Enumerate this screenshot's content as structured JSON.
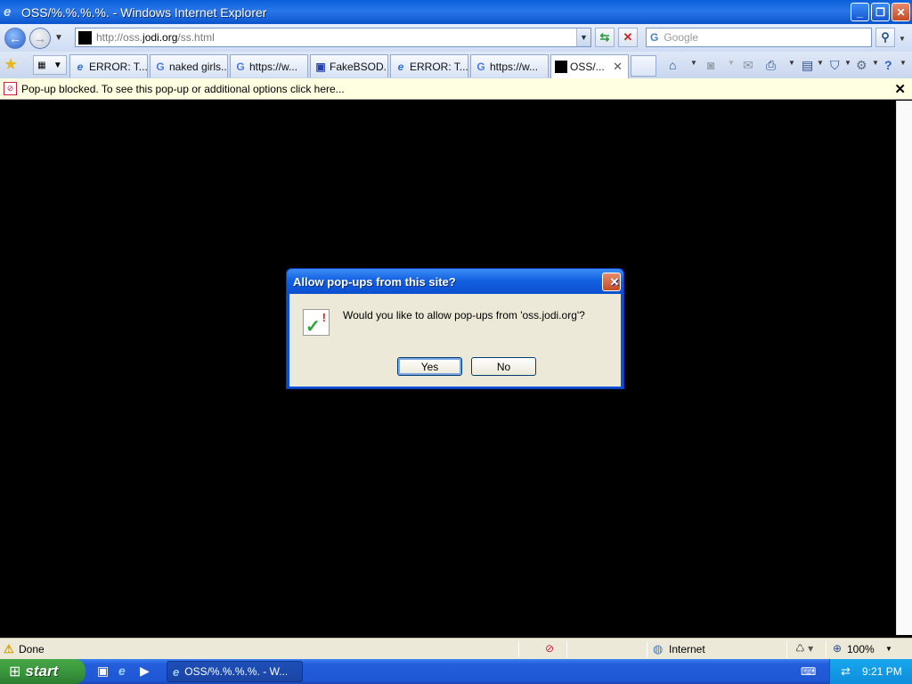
{
  "window": {
    "title": "OSS/%.%.%.%. - Windows Internet Explorer",
    "buttons": {
      "minimize": "_",
      "restore": "❐",
      "close": "✕"
    }
  },
  "address_bar": {
    "url_prefix": "http://oss.",
    "url_domain": "jodi.org",
    "url_path": "/ss.html",
    "search_placeholder": "Google"
  },
  "tabs": [
    {
      "label": "ERROR: T...",
      "icon": "ie-icon",
      "glyph": "e",
      "active": false
    },
    {
      "label": "naked girls...",
      "icon": "google-icon",
      "glyph": "G",
      "active": false
    },
    {
      "label": "https://w...",
      "icon": "google-icon",
      "glyph": "G",
      "active": false
    },
    {
      "label": "FakeBSOD...",
      "icon": "monitor-icon",
      "glyph": "▣",
      "active": false
    },
    {
      "label": "ERROR: T...",
      "icon": "ie-icon",
      "glyph": "e",
      "active": false
    },
    {
      "label": "https://w...",
      "icon": "google-icon",
      "glyph": "G",
      "active": false
    },
    {
      "label": "OSS/...",
      "icon": "black-square-icon",
      "glyph": "",
      "active": true
    }
  ],
  "infobar": {
    "message": "Pop-up blocked. To see this pop-up or additional options click here..."
  },
  "dialog": {
    "title": "Allow pop-ups from this site?",
    "message": "Would you like to allow pop-ups from 'oss.jodi.org'?",
    "yes_label": "Yes",
    "no_label": "No"
  },
  "status_bar": {
    "status": "Done",
    "zone": "Internet",
    "zoom": "100%"
  },
  "taskbar": {
    "start_label": "start",
    "task_label": "OSS/%.%.%.%. - W...",
    "clock": "9:21 PM"
  }
}
